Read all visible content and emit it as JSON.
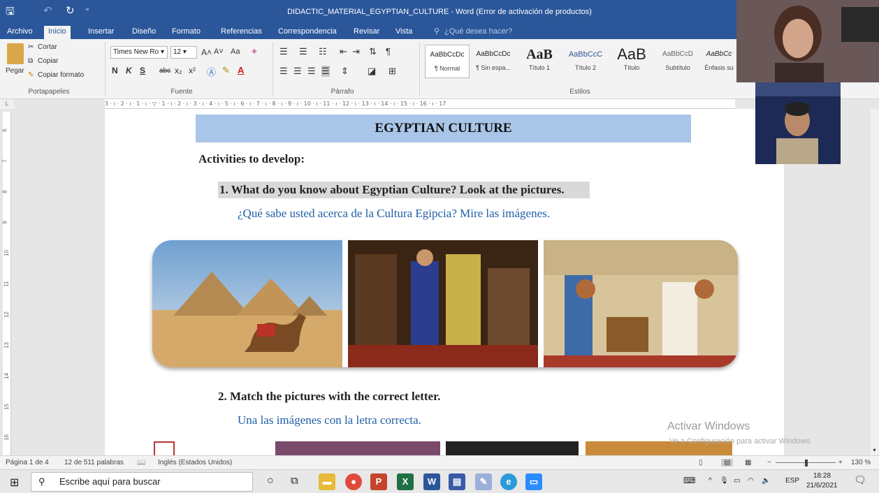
{
  "window": {
    "title": "DIDACTIC_MATERIAL_EGYPTIAN_CULTURE - Word (Error de activación de productos)"
  },
  "ribbon": {
    "tabs": [
      "Archivo",
      "Inicio",
      "Insertar",
      "Diseño",
      "Formato",
      "Referencias",
      "Correspondencia",
      "Revisar",
      "Vista"
    ],
    "tell_me": "¿Qué desea hacer?",
    "clipboard": {
      "paste": "Pegar",
      "cut": "Cortar",
      "copy": "Copiar",
      "format_painter": "Copiar formato",
      "group": "Portapapeles"
    },
    "font": {
      "name": "Times New Ro",
      "size": "12",
      "case": "Aa",
      "group": "Fuente",
      "bold": "N",
      "italic": "K",
      "underline": "S",
      "strike": "abc",
      "sub": "x₂",
      "sup": "x²"
    },
    "paragraph": {
      "group": "Párrafo"
    },
    "styles": {
      "group": "Estilos",
      "items": [
        {
          "preview": "AaBbCcDc",
          "name": "¶ Normal"
        },
        {
          "preview": "AaBbCcDc",
          "name": "¶ Sin espa..."
        },
        {
          "preview": "AaB",
          "name": "Título 1"
        },
        {
          "preview": "AaBbCcC",
          "name": "Título 2"
        },
        {
          "preview": "AaB",
          "name": "Título"
        },
        {
          "preview": "AaBbCcD",
          "name": "Subtítulo"
        },
        {
          "preview": "AaBbCc",
          "name": "Énfasis su"
        }
      ]
    }
  },
  "ruler": {
    "corner": "L",
    "marks": "3 · ı · 2 · ı · 1 · ı · ▽ · 1 · ı · 2 · ı · 3 · ı · 4 · ı · 5 · ı · 6 · ı · 7 · ı · 8 · ı · 9 · ı · 10 · ı · 11 · ı · 12 · ı · 13 · ı · 14 · ı · 15 · ı · 16 · ı · 17",
    "vertical": [
      "6",
      "7",
      "8",
      "9",
      "10",
      "11",
      "12",
      "13",
      "14",
      "15",
      "16"
    ]
  },
  "document": {
    "heading": "EGYPTIAN CULTURE",
    "activities": "Activities to develop:",
    "q1": "1.  What do you know about Egyptian Culture? Look at the pictures.",
    "q1_es": "¿Qué sabe usted acerca de la Cultura Egipcia? Mire las imágenes.",
    "q2": "2.  Match the pictures with the correct letter.",
    "q2_es": "Una las imágenes con la letra correcta."
  },
  "watermark": {
    "line1": "Activar Windows",
    "line2": "Ve a Configuración para activar Windows."
  },
  "status": {
    "page": "Página 1 de 4",
    "words": "12 de 511 palabras",
    "language": "Inglés (Estados Unidos)",
    "zoom": "130 %"
  },
  "taskbar": {
    "search_placeholder": "Escribe aquí para buscar",
    "lang": "ESP",
    "time": "18:28",
    "date": "21/6/2021"
  }
}
